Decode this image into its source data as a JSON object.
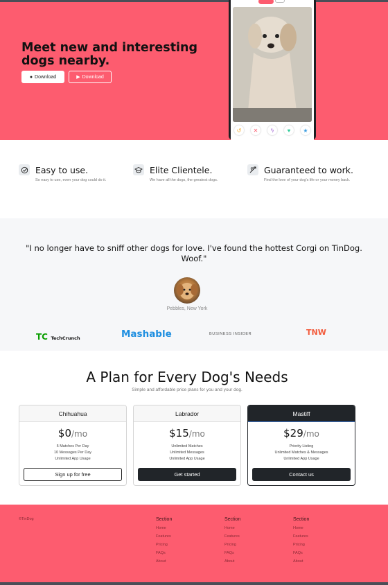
{
  "hero": {
    "title": "Meet new and interesting dogs nearby.",
    "download_apple": "Download",
    "download_play": "Download",
    "phone_actions": [
      "undo-icon",
      "close-icon",
      "bolt-icon",
      "heart-icon",
      "star-icon"
    ]
  },
  "features": [
    {
      "title": "Easy to use.",
      "text": "So easy to use, even your dog could do it.",
      "icon": "check-circle-icon"
    },
    {
      "title": "Elite Clientele.",
      "text": "We have all the dogs, the greatest dogs.",
      "icon": "graduation-cap-icon"
    },
    {
      "title": "Guaranteed to work.",
      "text": "Find the love of your dog's life or your money back.",
      "icon": "heart-arrow-icon"
    }
  ],
  "testimonial": {
    "quote": "\"I no longer have to sniff other dogs for love. I've found the hottest Corgi on TinDog. Woof.\"",
    "author": "Pebbles, New York"
  },
  "press": [
    "TechCrunch",
    "Mashable",
    "BUSINESS INSIDER",
    "TNW"
  ],
  "pricing": {
    "title": "A Plan for Every Dog's Needs",
    "subtitle": "Simple and affordable price plans for you and your dog.",
    "plans": [
      {
        "name": "Chihuahua",
        "price": "$0",
        "period": "/mo",
        "features": [
          "5 Matches Per Day",
          "10 Messages Per Day",
          "Unlimited App Usage"
        ],
        "cta": "Sign up for free"
      },
      {
        "name": "Labrador",
        "price": "$15",
        "period": "/mo",
        "features": [
          "Unlimited Matches",
          "Unlimited Messages",
          "Unlimited App Usage"
        ],
        "cta": "Get started"
      },
      {
        "name": "Mastiff",
        "price": "$29",
        "period": "/mo",
        "features": [
          "Priority Listing",
          "Unlimited Matches & Messages",
          "Unlimited App Usage"
        ],
        "cta": "Contact us"
      }
    ]
  },
  "footer": {
    "copyright": "©TinDog",
    "columns": [
      {
        "title": "Section",
        "links": [
          "Home",
          "Features",
          "Pricing",
          "FAQs",
          "About"
        ]
      },
      {
        "title": "Section",
        "links": [
          "Home",
          "Features",
          "Pricing",
          "FAQs",
          "About"
        ]
      },
      {
        "title": "Section",
        "links": [
          "Home",
          "Features",
          "Pricing",
          "FAQs",
          "About"
        ]
      }
    ]
  },
  "colors": {
    "brand": "#fd5c6f",
    "dark": "#212529",
    "light_bg": "#f6f7f9"
  }
}
